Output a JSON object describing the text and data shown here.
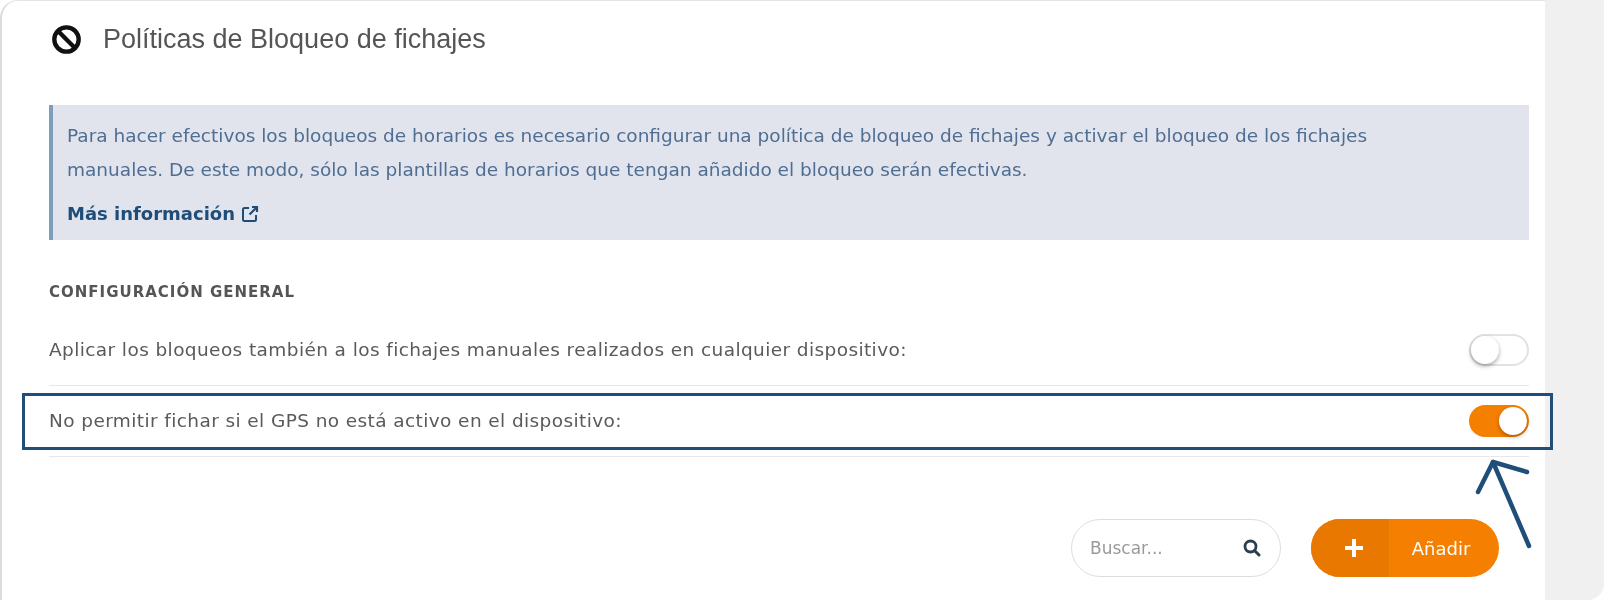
{
  "header": {
    "title": "Políticas de Bloqueo de fichajes"
  },
  "notice": {
    "text": "Para hacer efectivos los bloqueos de horarios es necesario configurar una política de bloqueo de fichajes y activar el bloqueo de los fichajes manuales. De este modo, sólo las plantillas de horarios que tengan añadido el bloqueo serán efectivas.",
    "link": "Más información"
  },
  "section": {
    "heading": "CONFIGURACIÓN GENERAL",
    "settings": [
      {
        "label": "Aplicar los bloqueos también a los fichajes manuales realizados en cualquier dispositivo:",
        "on": false,
        "highlighted": false
      },
      {
        "label": "No permitir fichar si el GPS no está activo en el dispositivo:",
        "on": true,
        "highlighted": true
      }
    ]
  },
  "toolbar": {
    "search": {
      "placeholder": "Buscar..."
    },
    "add_button": {
      "label": "Añadir"
    }
  }
}
